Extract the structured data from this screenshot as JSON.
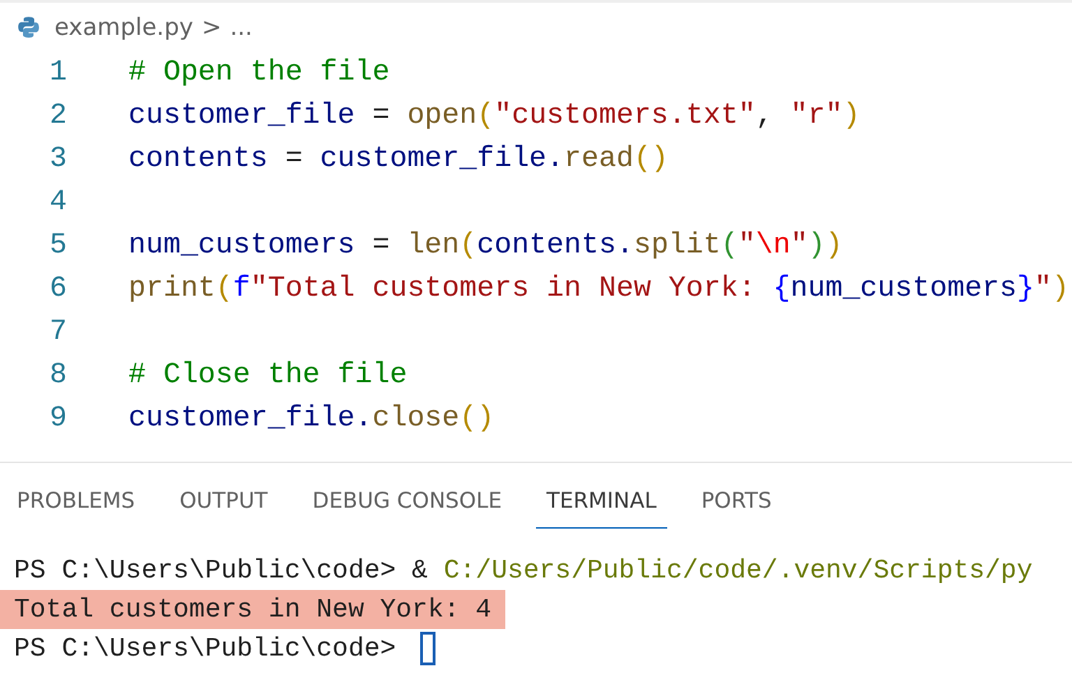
{
  "breadcrumb": {
    "file": "example.py",
    "separator": ">",
    "more": "..."
  },
  "code_lines": [
    {
      "number": "1",
      "tokens": [
        {
          "text": "# Open the file",
          "kind": "comment"
        }
      ]
    },
    {
      "number": "2",
      "tokens": [
        {
          "text": "customer_file",
          "kind": "var"
        },
        {
          "text": " = ",
          "kind": "op"
        },
        {
          "text": "open",
          "kind": "func"
        },
        {
          "text": "(",
          "kind": "paren"
        },
        {
          "text": "\"customers.txt\"",
          "kind": "string"
        },
        {
          "text": ", ",
          "kind": "op"
        },
        {
          "text": "\"r\"",
          "kind": "string"
        },
        {
          "text": ")",
          "kind": "paren"
        }
      ]
    },
    {
      "number": "3",
      "tokens": [
        {
          "text": "contents",
          "kind": "var"
        },
        {
          "text": " = ",
          "kind": "op"
        },
        {
          "text": "customer_file.",
          "kind": "var"
        },
        {
          "text": "read",
          "kind": "func"
        },
        {
          "text": "()",
          "kind": "paren"
        }
      ]
    },
    {
      "number": "4"
    },
    {
      "number": "5",
      "tokens": [
        {
          "text": "num_customers",
          "kind": "var"
        },
        {
          "text": " = ",
          "kind": "op"
        },
        {
          "text": "len",
          "kind": "func"
        },
        {
          "text": "(",
          "kind": "paren"
        },
        {
          "text": "contents.",
          "kind": "var"
        },
        {
          "text": "split",
          "kind": "func"
        },
        {
          "text": "(",
          "kind": "paren2"
        },
        {
          "text": "\"",
          "kind": "string"
        },
        {
          "text": "\\n",
          "kind": "escape"
        },
        {
          "text": "\"",
          "kind": "string"
        },
        {
          "text": ")",
          "kind": "paren2"
        },
        {
          "text": ")",
          "kind": "paren"
        }
      ]
    },
    {
      "number": "6",
      "tokens": [
        {
          "text": "print",
          "kind": "func"
        },
        {
          "text": "(",
          "kind": "paren"
        },
        {
          "text": "f",
          "kind": "keyword"
        },
        {
          "text": "\"Total customers in New York: ",
          "kind": "string"
        },
        {
          "text": "{",
          "kind": "brace"
        },
        {
          "text": "num_customers",
          "kind": "var"
        },
        {
          "text": "}",
          "kind": "brace"
        },
        {
          "text": "\"",
          "kind": "string"
        },
        {
          "text": ")",
          "kind": "paren"
        }
      ]
    },
    {
      "number": "7"
    },
    {
      "number": "8",
      "tokens": [
        {
          "text": "# Close the file",
          "kind": "comment"
        }
      ]
    },
    {
      "number": "9",
      "tokens": [
        {
          "text": "customer_file.",
          "kind": "var"
        },
        {
          "text": "close",
          "kind": "func"
        },
        {
          "text": "()",
          "kind": "paren"
        }
      ]
    }
  ],
  "panel_tabs": [
    {
      "label": "PROBLEMS",
      "selected": false
    },
    {
      "label": "OUTPUT",
      "selected": false
    },
    {
      "label": "DEBUG CONSOLE",
      "selected": false
    },
    {
      "label": "TERMINAL",
      "selected": true
    },
    {
      "label": "PORTS",
      "selected": false
    }
  ],
  "terminal_lines": [
    {
      "highlighted": false,
      "cursor": false,
      "tokens": [
        {
          "text": "PS C:\\Users\\Public\\code> & ",
          "kind": "plain"
        },
        {
          "text": "C:/Users/Public/code/.venv/Scripts/py",
          "kind": "path"
        }
      ]
    },
    {
      "highlighted": true,
      "cursor": false,
      "tokens": [
        {
          "text": "Total customers in New York: 4",
          "kind": "plain"
        }
      ]
    },
    {
      "highlighted": false,
      "cursor": true,
      "tokens": [
        {
          "text": "PS C:\\Users\\Public\\code> ",
          "kind": "plain"
        }
      ]
    }
  ]
}
